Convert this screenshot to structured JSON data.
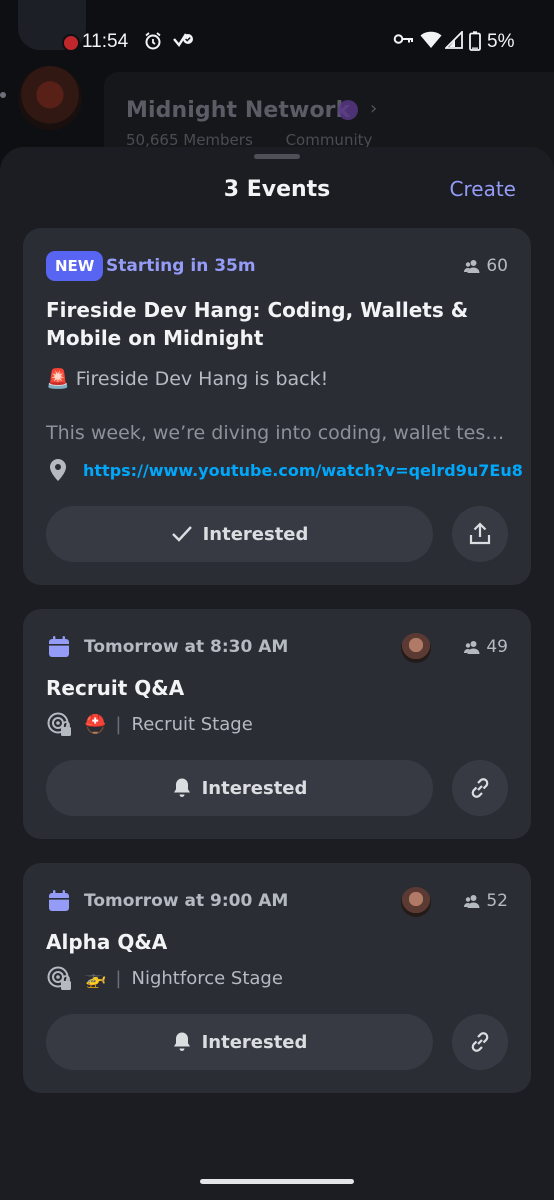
{
  "status_bar": {
    "time": "11:54",
    "battery": "5%"
  },
  "background": {
    "server_name": "Midnight Network",
    "members": "50,665 Members",
    "community": "Community"
  },
  "sheet": {
    "title": "3 Events",
    "create_label": "Create"
  },
  "events": [
    {
      "badge": "NEW",
      "starting": "Starting in 35m",
      "interested_count": "60",
      "title": "Fireside Dev Hang: Coding, Wallets & Mobile on Midnight",
      "description_line1": "🚨 Fireside Dev Hang is back!",
      "description_line2": "This week, we’re diving into coding, wallet tes…",
      "location": "https://www.youtube.com/watch?v=qelrd9u7Eu8",
      "interested_label": "Interested",
      "action_icon": "share-icon"
    },
    {
      "when": "Tomorrow at 8:30 AM",
      "interested_count": "49",
      "title": "Recruit Q&A",
      "stage_emoji": "⛑️",
      "stage_name": "Recruit Stage",
      "interested_label": "Interested",
      "action_icon": "link-icon"
    },
    {
      "when": "Tomorrow at 9:00 AM",
      "interested_count": "52",
      "title": "Alpha Q&A",
      "stage_emoji": "🚁",
      "stage_name": "Nightforce Stage",
      "interested_label": "Interested",
      "action_icon": "link-icon"
    }
  ],
  "colors": {
    "accent": "#5865f2",
    "accent_text": "#949cf7",
    "link": "#00a8fc",
    "card": "#2b2d35",
    "sheet": "#1c1d23"
  }
}
